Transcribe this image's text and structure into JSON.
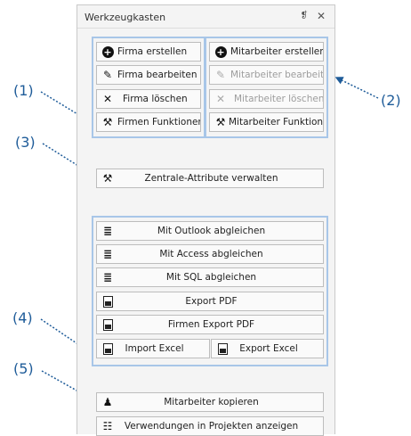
{
  "panel": {
    "title": "Werkzeugkasten",
    "pin_glyph": "❡",
    "close_glyph": "✕"
  },
  "callouts": [
    "(1)",
    "(2)",
    "(3)",
    "(4)",
    "(5)"
  ],
  "firma_group": [
    {
      "label": "Firma erstellen",
      "icon": "plus-circle-icon",
      "glyph": "+"
    },
    {
      "label": "Firma bearbeiten",
      "icon": "edit-icon",
      "glyph": "✎"
    },
    {
      "label": "Firma löschen",
      "icon": "delete-x-icon",
      "glyph": "✕"
    },
    {
      "label": "Firmen Funktionen",
      "icon": "tools-icon",
      "glyph": "⚒"
    }
  ],
  "mitarbeiter_group": [
    {
      "label": "Mitarbeiter erstellen",
      "icon": "plus-circle-icon",
      "glyph": "+",
      "enabled": true
    },
    {
      "label": "Mitarbeiter bearbeiten",
      "icon": "edit-icon",
      "glyph": "✎",
      "enabled": false
    },
    {
      "label": "Mitarbeiter löschen",
      "icon": "delete-x-icon",
      "glyph": "✕",
      "enabled": false
    },
    {
      "label": "Mitarbeiter Funktionen",
      "icon": "tools-icon",
      "glyph": "⚒",
      "enabled": true
    }
  ],
  "attribute_button": {
    "label": "Zentrale-Attribute verwalten",
    "icon": "tools-icon",
    "glyph": "⚒"
  },
  "sync_group": [
    {
      "label": "Mit Outlook abgleichen",
      "icon": "sync-list-icon",
      "glyph": "≣"
    },
    {
      "label": "Mit Access abgleichen",
      "icon": "sync-list-icon",
      "glyph": "≣"
    },
    {
      "label": "Mit SQL abgleichen",
      "icon": "sync-list-icon",
      "glyph": "≣"
    },
    {
      "label": "Export PDF",
      "icon": "pdf-icon",
      "glyph": ""
    },
    {
      "label": "Firmen Export PDF",
      "icon": "pdf-icon",
      "glyph": ""
    }
  ],
  "excel_buttons": [
    {
      "label": "Import Excel",
      "icon": "excel-import-icon"
    },
    {
      "label": "Export Excel",
      "icon": "excel-export-icon"
    }
  ],
  "bottom_buttons": [
    {
      "label": "Mitarbeiter kopieren",
      "icon": "copy-users-icon",
      "glyph": "♟"
    },
    {
      "label": "Verwendungen in Projekten anzeigen",
      "icon": "projects-icon",
      "glyph": "☷"
    }
  ],
  "colors": {
    "group_border": "#a8c6e8",
    "callout": "#1f5c99",
    "disabled_text": "#9d9d9d"
  }
}
